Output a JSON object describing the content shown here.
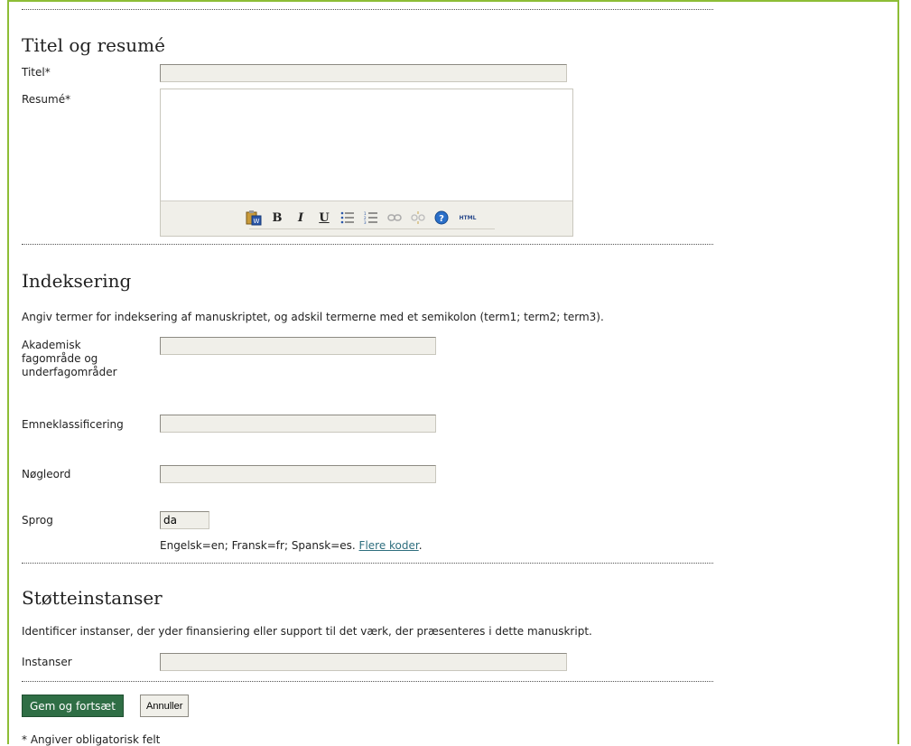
{
  "sections": {
    "title_abstract": {
      "heading": "Titel og resumé",
      "title_label": "Titel*",
      "title_value": "",
      "abstract_label": "Resumé*"
    },
    "indexing": {
      "heading": "Indeksering",
      "description": "Angiv termer for indeksering af manuskriptet, og adskil termerne med et semikolon (term1; term2; term3).",
      "discipline_label_lines": [
        "Akademisk",
        "fagområde og",
        "underfagområder"
      ],
      "subject_class_label": "Emneklassificering",
      "keywords_label": "Nøgleord",
      "language_label": "Sprog",
      "language_value": "da",
      "language_hint": "Engelsk=en; Fransk=fr; Spansk=es.",
      "language_hint_link": "Flere koder"
    },
    "sponsors": {
      "heading": "Støtteinstanser",
      "description": "Identificer instanser, der yder finansiering eller support til det værk, der præsenteres i dette manuskript.",
      "agencies_label": "Instanser"
    }
  },
  "editor_toolbar": {
    "icons": [
      "paste-word-icon",
      "bold-icon",
      "italic-icon",
      "underline-icon",
      "bullet-list-icon",
      "numbered-list-icon",
      "link-icon",
      "unlink-icon",
      "help-icon",
      "html-icon"
    ],
    "bold": "B",
    "italic": "I",
    "underline": "U",
    "html": "HTML"
  },
  "actions": {
    "save_continue": "Gem og fortsæt",
    "cancel": "Annuller"
  },
  "footnote": "* Angiver obligatorisk felt",
  "colors": {
    "frame": "#8dbd36",
    "primary_button": "#2f6e45",
    "link": "#2e6e7e",
    "field_bg": "#f0efe9"
  }
}
